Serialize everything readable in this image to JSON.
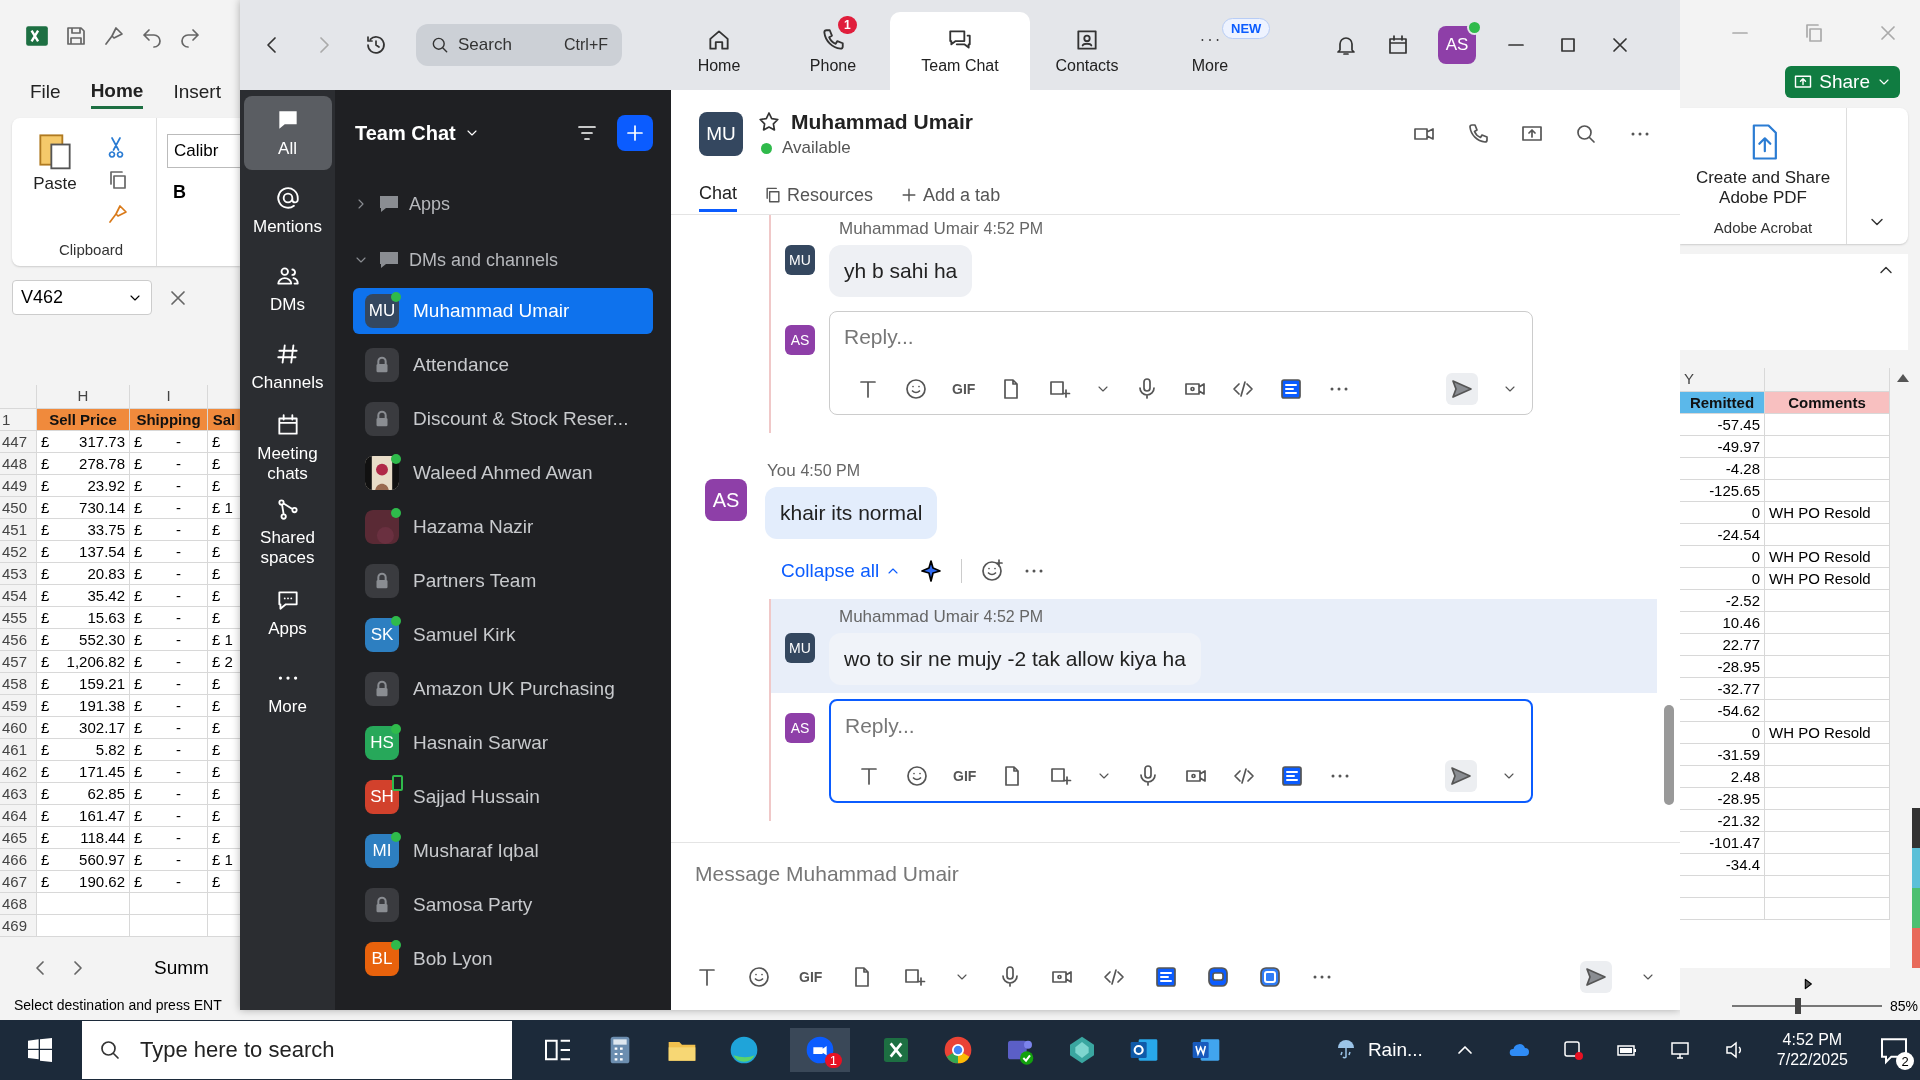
{
  "excel": {
    "tabs": [
      {
        "label": "File",
        "selected": false
      },
      {
        "label": "Home",
        "selected": true
      },
      {
        "label": "Insert",
        "selected": false
      }
    ],
    "paste": "Paste",
    "clipboard": "Clipboard",
    "font": "Calibr",
    "bold": "B",
    "name_box": "V462",
    "columns_left": [
      "H",
      "I"
    ],
    "column_right": "Y",
    "header_row": "1",
    "headers": [
      {
        "label": "Sell Price",
        "color": "#f08a3c"
      },
      {
        "label": "Shipping",
        "color": "#f08a3c"
      },
      {
        "label": "Sal",
        "color": "#f08a3c"
      },
      {
        "label": "Remitted",
        "color": "#5bb8ea"
      },
      {
        "label": "Comments",
        "color": "#f8c0c0"
      }
    ],
    "rows": [
      {
        "n": "447",
        "price": [
          "£",
          "317.73"
        ],
        "ship": [
          "£",
          "-"
        ],
        "sal": [
          "£"
        ],
        "remit": "-57.45"
      },
      {
        "n": "448",
        "price": [
          "£",
          "278.78"
        ],
        "ship": [
          "£",
          "-"
        ],
        "sal": [
          "£"
        ],
        "remit": "-49.97"
      },
      {
        "n": "449",
        "price": [
          "£",
          "23.92"
        ],
        "ship": [
          "£",
          "-"
        ],
        "sal": [
          "£"
        ],
        "remit": "-4.28"
      },
      {
        "n": "450",
        "price": [
          "£",
          "730.14"
        ],
        "ship": [
          "£",
          "-"
        ],
        "sal": [
          "£",
          "1"
        ],
        "remit": "-125.65"
      },
      {
        "n": "451",
        "price": [
          "£",
          "33.75"
        ],
        "ship": [
          "£",
          "-"
        ],
        "sal": [
          "£"
        ],
        "remit": "0",
        "comment": "WH PO Resold"
      },
      {
        "n": "452",
        "price": [
          "£",
          "137.54"
        ],
        "ship": [
          "£",
          "-"
        ],
        "sal": [
          "£"
        ],
        "remit": "-24.54"
      },
      {
        "n": "453",
        "price": [
          "£",
          "20.83"
        ],
        "ship": [
          "£",
          "-"
        ],
        "sal": [
          "£"
        ],
        "remit": "0",
        "comment": "WH PO Resold"
      },
      {
        "n": "454",
        "price": [
          "£",
          "35.42"
        ],
        "ship": [
          "£",
          "-"
        ],
        "sal": [
          "£"
        ],
        "remit": "0",
        "comment": "WH PO Resold"
      },
      {
        "n": "455",
        "price": [
          "£",
          "15.63"
        ],
        "ship": [
          "£",
          "-"
        ],
        "sal": [
          "£"
        ],
        "remit": "-2.52"
      },
      {
        "n": "456",
        "price": [
          "£",
          "552.30"
        ],
        "ship": [
          "£",
          "-"
        ],
        "sal": [
          "£",
          "1"
        ],
        "remit": "10.46"
      },
      {
        "n": "457",
        "price": [
          "£",
          "1,206.82"
        ],
        "ship": [
          "£",
          "-"
        ],
        "sal": [
          "£",
          "2"
        ],
        "remit": "22.77"
      },
      {
        "n": "458",
        "price": [
          "£",
          "159.21"
        ],
        "ship": [
          "£",
          "-"
        ],
        "sal": [
          "£"
        ],
        "remit": "-28.95"
      },
      {
        "n": "459",
        "price": [
          "£",
          "191.38"
        ],
        "ship": [
          "£",
          "-"
        ],
        "sal": [
          "£"
        ],
        "remit": "-32.77"
      },
      {
        "n": "460",
        "price": [
          "£",
          "302.17"
        ],
        "ship": [
          "£",
          "-"
        ],
        "sal": [
          "£"
        ],
        "remit": "-54.62"
      },
      {
        "n": "461",
        "price": [
          "£",
          "5.82"
        ],
        "ship": [
          "£",
          "-"
        ],
        "sal": [
          "£"
        ],
        "remit": "0",
        "comment": "WH PO Resold"
      },
      {
        "n": "462",
        "price": [
          "£",
          "171.45"
        ],
        "ship": [
          "£",
          "-"
        ],
        "sal": [
          "£"
        ],
        "remit": "-31.59"
      },
      {
        "n": "463",
        "price": [
          "£",
          "62.85"
        ],
        "ship": [
          "£",
          "-"
        ],
        "sal": [
          "£"
        ],
        "remit": "2.48"
      },
      {
        "n": "464",
        "price": [
          "£",
          "161.47"
        ],
        "ship": [
          "£",
          "-"
        ],
        "sal": [
          "£"
        ],
        "remit": "-28.95"
      },
      {
        "n": "465",
        "price": [
          "£",
          "118.44"
        ],
        "ship": [
          "£",
          "-"
        ],
        "sal": [
          "£"
        ],
        "remit": "-21.32"
      },
      {
        "n": "466",
        "price": [
          "£",
          "560.97"
        ],
        "ship": [
          "£",
          "-"
        ],
        "sal": [
          "£",
          "1"
        ],
        "remit": "-101.47"
      },
      {
        "n": "467",
        "price": [
          "£",
          "190.62"
        ],
        "ship": [
          "£",
          "-"
        ],
        "sal": [
          "£"
        ],
        "remit": "-34.4"
      },
      {
        "n": "468"
      },
      {
        "n": "469"
      }
    ],
    "sheet_tab": "Summ",
    "status": "Select destination and press ENT",
    "share": "Share",
    "acrobat_button": "Create and Share Adobe PDF",
    "acrobat_group": "Adobe Acrobat",
    "zoom_slider": {
      "level": 0.42
    },
    "zoom_level": "85%"
  },
  "zoom": {
    "search": {
      "placeholder": "Search",
      "shortcut": "Ctrl+F"
    },
    "nav": [
      {
        "label": "Home",
        "selected": false
      },
      {
        "label": "Phone",
        "selected": false,
        "badge": "1"
      },
      {
        "label": "Team Chat",
        "selected": true
      },
      {
        "label": "Contacts",
        "selected": false
      },
      {
        "label": "More",
        "selected": false,
        "badge": "NEW"
      }
    ],
    "avatar": "AS",
    "rail": [
      {
        "label": "All",
        "selected": true
      },
      {
        "label": "Mentions",
        "selected": false
      },
      {
        "label": "DMs",
        "selected": false
      },
      {
        "label": "Channels",
        "selected": false
      },
      {
        "label": "Meeting chats",
        "selected": false
      },
      {
        "label": "Shared spaces",
        "selected": false
      },
      {
        "label": "Apps",
        "selected": false
      },
      {
        "label": "More",
        "selected": false
      }
    ],
    "list_title": "Team Chat",
    "sections": [
      {
        "label": "Apps",
        "expanded": false
      },
      {
        "label": "DMs and channels",
        "expanded": true
      }
    ],
    "chats": [
      {
        "name": "Muhammad Umair",
        "kind": "initials",
        "initials": "MU",
        "color": "#34475f",
        "online": true,
        "mobile": false,
        "selected": true
      },
      {
        "name": "Attendance",
        "kind": "lock",
        "online": false,
        "mobile": false,
        "selected": false
      },
      {
        "name": "Discount & Stock Reser...",
        "kind": "lock",
        "online": false,
        "mobile": false,
        "selected": false
      },
      {
        "name": "Waleed Ahmed Awan",
        "kind": "picture",
        "online": true,
        "mobile": false,
        "selected": false
      },
      {
        "name": "Hazama Nazir",
        "kind": "picture",
        "online": true,
        "mobile": false,
        "selected": false
      },
      {
        "name": "Partners Team",
        "kind": "lock",
        "online": false,
        "mobile": false,
        "selected": false
      },
      {
        "name": "Samuel Kirk",
        "kind": "initials",
        "initials": "SK",
        "color": "#2d7fc1",
        "online": true,
        "mobile": false,
        "selected": false
      },
      {
        "name": "Amazon UK Purchasing",
        "kind": "lock",
        "online": false,
        "mobile": false,
        "selected": false
      },
      {
        "name": "Hasnain Sarwar",
        "kind": "initials",
        "initials": "HS",
        "color": "#27a85a",
        "online": true,
        "mobile": false,
        "selected": false
      },
      {
        "name": "Sajjad Hussain",
        "kind": "initials",
        "initials": "SH",
        "color": "#d2412c",
        "online": false,
        "mobile": true,
        "selected": false
      },
      {
        "name": "Musharaf Iqbal",
        "kind": "initials",
        "initials": "MI",
        "color": "#2d7fc1",
        "online": true,
        "mobile": false,
        "selected": false
      },
      {
        "name": "Samosa Party",
        "kind": "lock",
        "online": false,
        "mobile": false,
        "selected": false
      },
      {
        "name": "Bob Lyon",
        "kind": "initials",
        "initials": "BL",
        "color": "#e8620c",
        "online": true,
        "mobile": false,
        "selected": false
      }
    ],
    "contact": {
      "initials": "MU",
      "name": "Muhammad Umair",
      "status": "Available",
      "starred": false
    },
    "tabs": [
      {
        "label": "Chat",
        "selected": true
      },
      {
        "label": "Resources",
        "selected": false
      },
      {
        "label": "Add a tab",
        "selected": false
      }
    ],
    "thread_top": {
      "sender": "Muhammad Umair",
      "time": "4:52 PM",
      "initials": "MU",
      "text": "yh b sahi ha"
    },
    "reply_top": {
      "initials": "AS",
      "placeholder": "Reply...",
      "focused": false,
      "gif": "GIF"
    },
    "message": {
      "sender": "You",
      "time": "4:50 PM",
      "initials": "AS",
      "text": "khair its normal"
    },
    "collapse": "Collapse all",
    "thread_reply": {
      "sender": "Muhammad Umair",
      "time": "4:52 PM",
      "initials": "MU",
      "text": "wo to sir ne mujy -2 tak allow kiya ha",
      "highlighted": true
    },
    "reply_bottom": {
      "initials": "AS",
      "placeholder": "Reply...",
      "focused": true,
      "gif": "GIF"
    },
    "composer": {
      "placeholder": "Message Muhammad Umair",
      "gif": "GIF"
    }
  },
  "taskbar": {
    "search": {
      "placeholder": "Type here to search"
    },
    "zoom_badge": "1",
    "weather": "Rain...",
    "time": "4:52 PM",
    "date": "7/22/2025",
    "notifications": "2"
  }
}
